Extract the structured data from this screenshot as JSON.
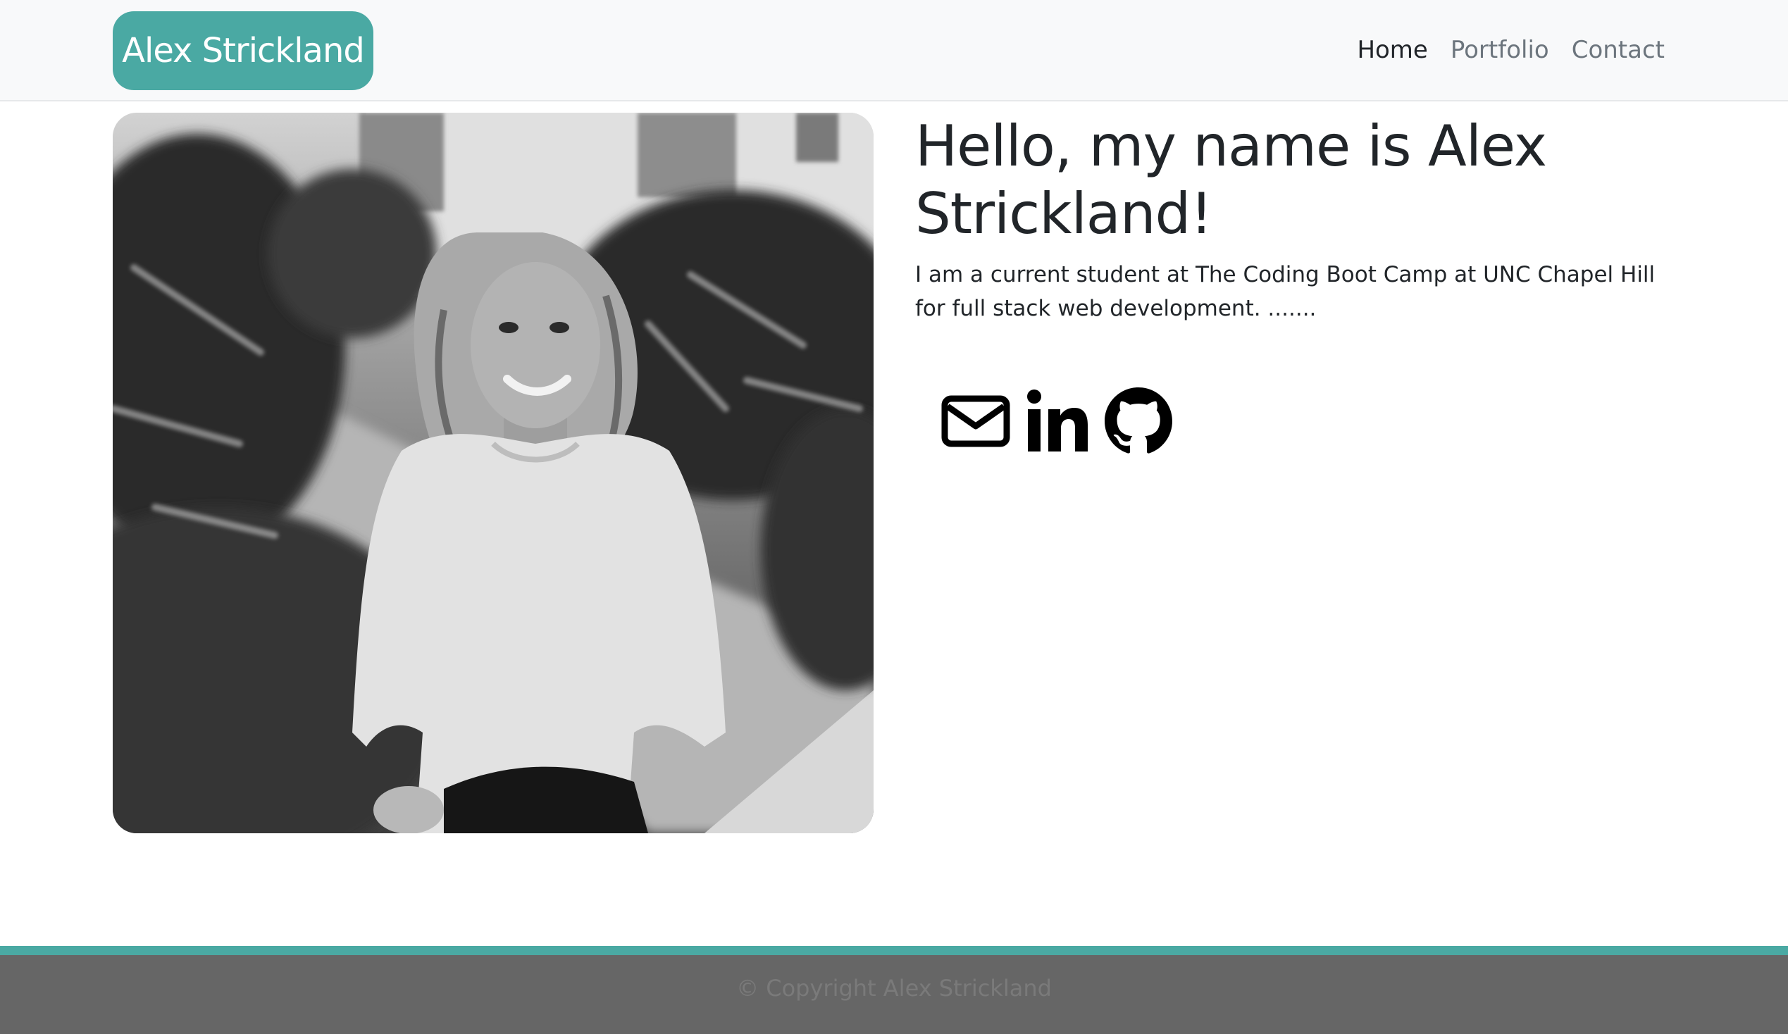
{
  "header": {
    "brand": "Alex Strickland",
    "nav": [
      {
        "label": "Home",
        "active": true
      },
      {
        "label": "Portfolio",
        "active": false
      },
      {
        "label": "Contact",
        "active": false
      }
    ]
  },
  "main": {
    "photo_icon": "profile-photo",
    "heading": "Hello, my name is Alex Strickland!",
    "bio": "I am a current student at The Coding Boot Camp at UNC Chapel Hill for full stack web development. .......",
    "social": [
      {
        "icon": "envelope-icon"
      },
      {
        "icon": "linkedin-icon"
      },
      {
        "icon": "github-icon"
      }
    ]
  },
  "footer": {
    "text": "© Copyright Alex Strickland"
  },
  "colors": {
    "accent": "#4aa9a3",
    "navbar_bg": "#f8f9fa",
    "footer_bg": "#666666",
    "text": "#212529",
    "nav_muted": "#6c757d"
  }
}
